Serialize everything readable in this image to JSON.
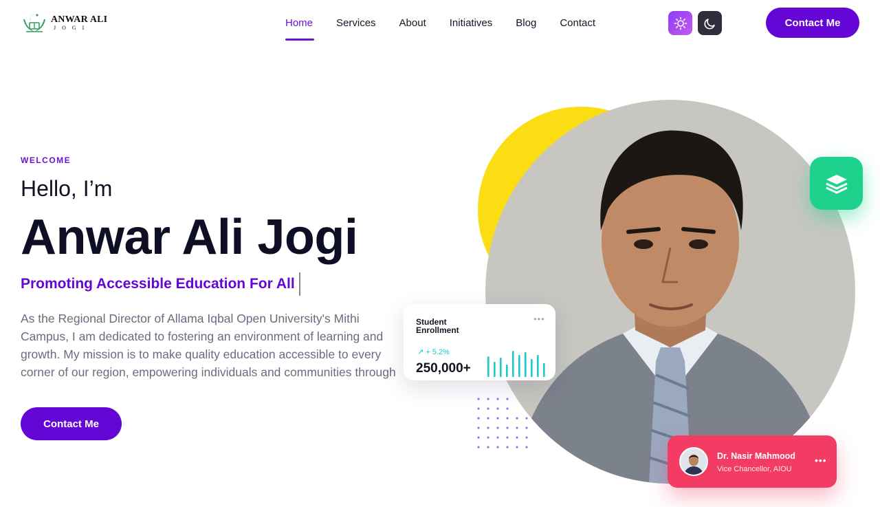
{
  "header": {
    "logo": {
      "line1": "ANWAR ALI",
      "line2": "JOGI"
    },
    "nav": [
      {
        "label": "Home",
        "active": true
      },
      {
        "label": "Services",
        "active": false
      },
      {
        "label": "About",
        "active": false
      },
      {
        "label": "Initiatives",
        "active": false
      },
      {
        "label": "Blog",
        "active": false
      },
      {
        "label": "Contact",
        "active": false
      }
    ],
    "theme_toggle": {
      "light_icon": "sun-icon",
      "dark_icon": "moon-icon"
    },
    "cta_label": "Contact Me"
  },
  "hero": {
    "eyebrow": "WELCOME",
    "greeting": "Hello, I’m",
    "name": "Anwar Ali Jogi",
    "tagline": "Promoting Accessible Education For All",
    "description": "As the Regional Director of Allama Iqbal Open University's Mithi Campus, I am dedicated to fostering an environment of learning and growth. My mission is to make quality education accessible to every corner of our region, empowering individuals and communities through knowledge.",
    "cta_label": "Contact Me"
  },
  "stat_card": {
    "title": "Student Enrollment",
    "change": "+ 5.2%",
    "value": "250,000+",
    "more_icon": "more-dots-icon"
  },
  "vc_card": {
    "name": "Dr. Nasir Mahmood",
    "role": "Vice Chancellor, AIOU",
    "more_icon": "more-dots-icon"
  },
  "colors": {
    "accent": "#6406d6",
    "yellow": "#fbdd14",
    "green": "#1ed28e",
    "pink": "#f23c64",
    "teal": "#1cc8c8"
  }
}
